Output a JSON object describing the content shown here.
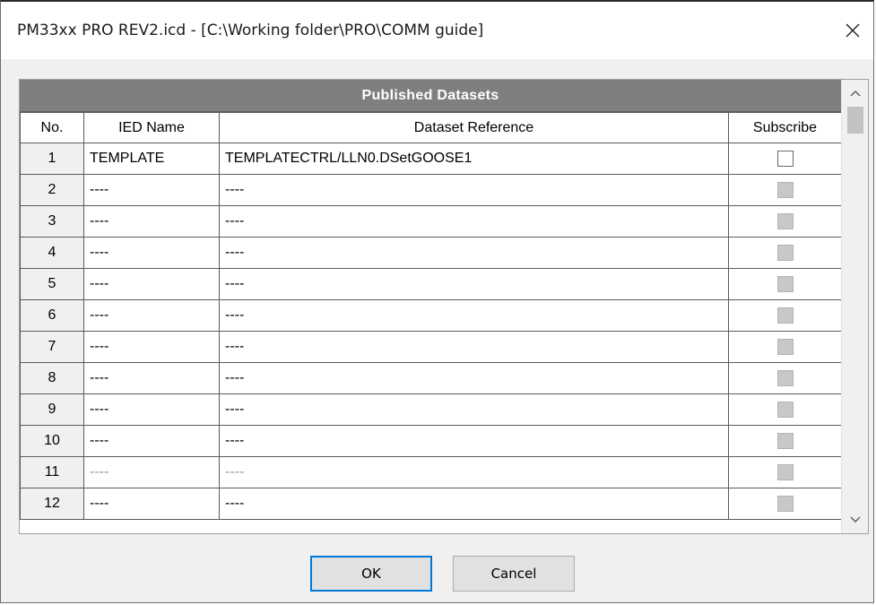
{
  "window": {
    "title": "PM33xx PRO REV2.icd - [C:\\Working folder\\PRO\\COMM guide]"
  },
  "table": {
    "caption": "Published Datasets",
    "columns": [
      "No.",
      "IED Name",
      "Dataset Reference",
      "Subscribe"
    ],
    "rows": [
      {
        "no": "1",
        "ied": "TEMPLATE",
        "ref": "TEMPLATECTRL/LLN0.DSetGOOSE1",
        "subscribe": "unchecked"
      },
      {
        "no": "2",
        "ied": "----",
        "ref": "----",
        "subscribe": "disabled"
      },
      {
        "no": "3",
        "ied": "----",
        "ref": "----",
        "subscribe": "disabled"
      },
      {
        "no": "4",
        "ied": "----",
        "ref": "----",
        "subscribe": "disabled"
      },
      {
        "no": "5",
        "ied": "----",
        "ref": "----",
        "subscribe": "disabled"
      },
      {
        "no": "6",
        "ied": "----",
        "ref": "----",
        "subscribe": "disabled"
      },
      {
        "no": "7",
        "ied": "----",
        "ref": "----",
        "subscribe": "disabled"
      },
      {
        "no": "8",
        "ied": "----",
        "ref": "----",
        "subscribe": "disabled"
      },
      {
        "no": "9",
        "ied": "----",
        "ref": "----",
        "subscribe": "disabled"
      },
      {
        "no": "10",
        "ied": "----",
        "ref": "----",
        "subscribe": "disabled"
      },
      {
        "no": "11",
        "ied": "----",
        "ref": "----",
        "subscribe": "disabled"
      },
      {
        "no": "12",
        "ied": "----",
        "ref": "----",
        "subscribe": "disabled"
      }
    ]
  },
  "buttons": {
    "ok": "OK",
    "cancel": "Cancel"
  },
  "icons": {
    "close": "close-icon",
    "scroll_up": "chevron-up-icon",
    "scroll_down": "chevron-down-icon"
  }
}
